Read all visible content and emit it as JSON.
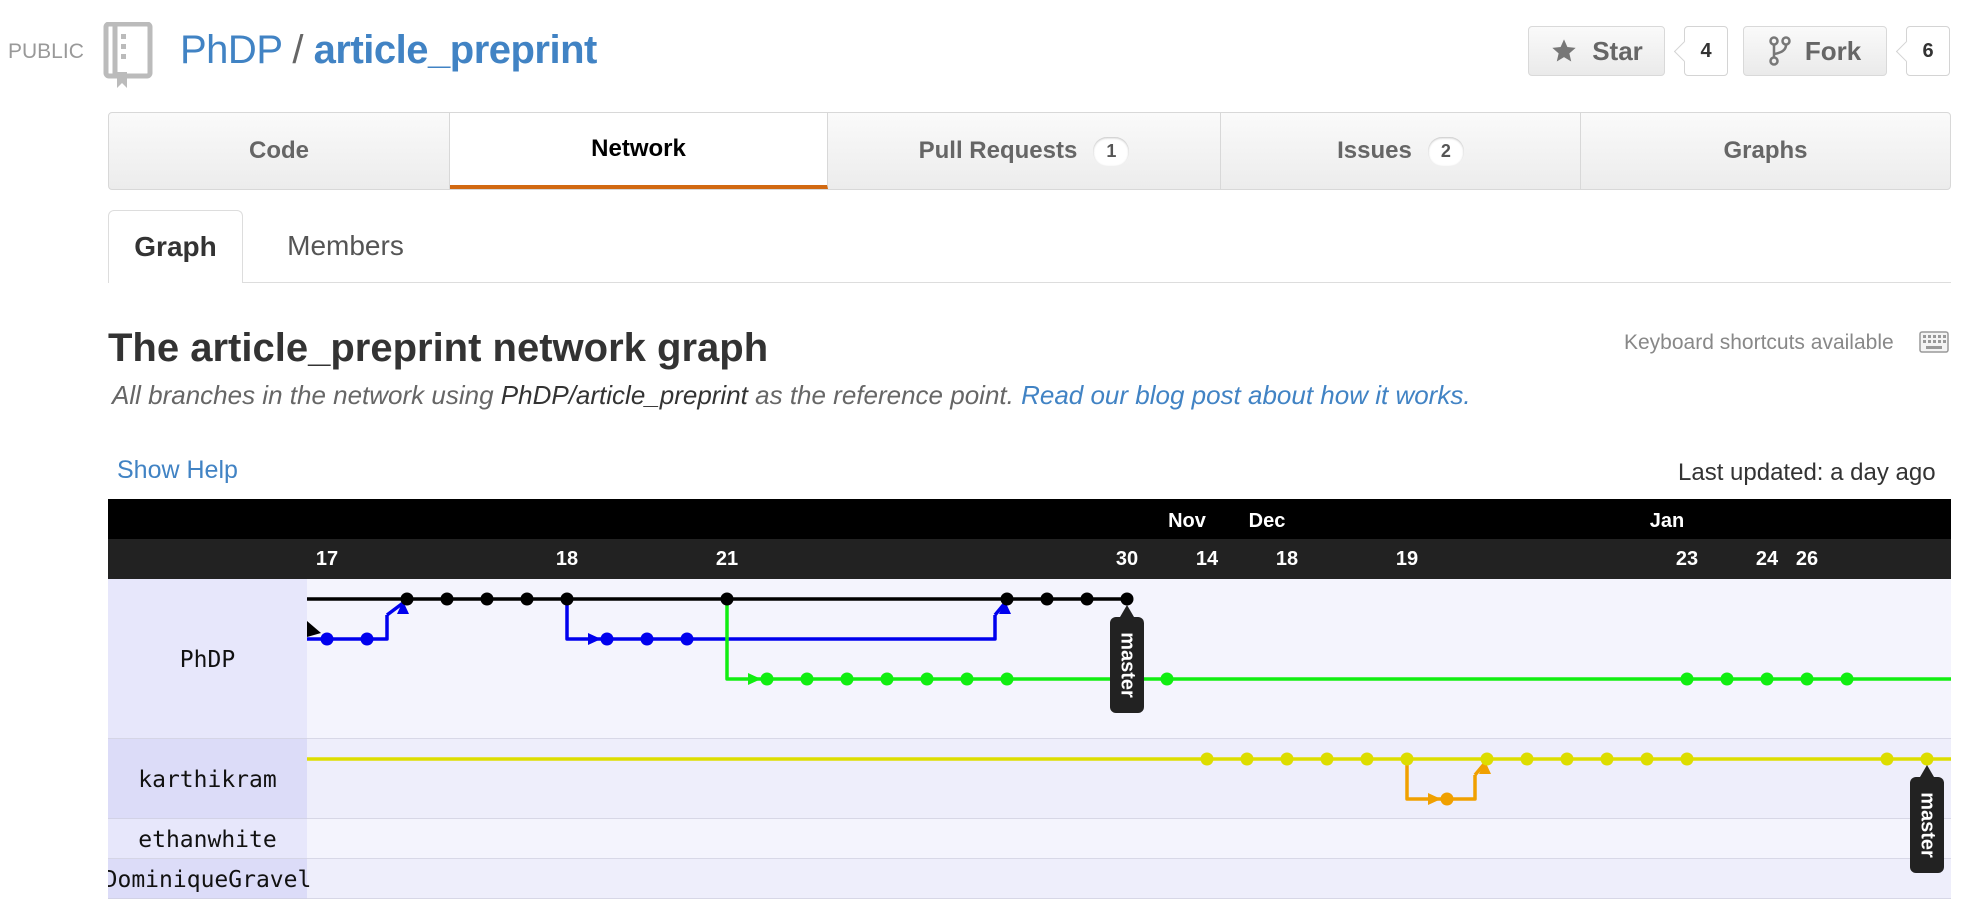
{
  "header": {
    "visibility": "PUBLIC",
    "owner": "PhDP",
    "separator": "/",
    "repo": "article_preprint",
    "star_label": "Star",
    "star_count": "4",
    "fork_label": "Fork",
    "fork_count": "6"
  },
  "tabs": [
    {
      "label": "Code"
    },
    {
      "label": "Network",
      "selected": true
    },
    {
      "label": "Pull Requests",
      "count": "1"
    },
    {
      "label": "Issues",
      "count": "2"
    },
    {
      "label": "Graphs"
    }
  ],
  "subnav": [
    {
      "label": "Graph",
      "selected": true
    },
    {
      "label": "Members"
    }
  ],
  "page": {
    "heading": "The article_preprint network graph",
    "keyboard_shortcuts": "Keyboard shortcuts available",
    "desc_prefix": "All branches in the network using ",
    "desc_ref": "PhDP/article_preprint",
    "desc_mid": " as the reference point. ",
    "desc_link": "Read our blog post about how it works.",
    "show_help": "Show Help",
    "last_updated": "Last updated: a day ago"
  },
  "graph": {
    "months": [
      {
        "label": "Nov",
        "col": 22.5
      },
      {
        "label": "Dec",
        "col": 24.5
      },
      {
        "label": "Jan",
        "col": 34.5
      }
    ],
    "days": [
      {
        "label": "17",
        "col": 1
      },
      {
        "label": "18",
        "col": 7
      },
      {
        "label": "21",
        "col": 11
      },
      {
        "label": "30",
        "col": 21
      },
      {
        "label": "14",
        "col": 23
      },
      {
        "label": "18",
        "col": 25
      },
      {
        "label": "19",
        "col": 28
      },
      {
        "label": "23",
        "col": 35
      },
      {
        "label": "24",
        "col": 37
      },
      {
        "label": "26",
        "col": 38
      }
    ],
    "users": [
      {
        "name": "PhDP",
        "rows": 4
      },
      {
        "name": "karthikram",
        "rows": 2
      },
      {
        "name": "ethanwhite",
        "rows": 1
      },
      {
        "name": "DominiqueGravel",
        "rows": 1
      }
    ],
    "colors": {
      "black": "#000000",
      "blue": "#0000ee",
      "green": "#11ee11",
      "yellow": "#dddd00",
      "orange": "#f0a000"
    },
    "commits": [
      {
        "color": "black",
        "row": 1,
        "cols": [
          3,
          4,
          5,
          6,
          7,
          11,
          18,
          19,
          20,
          21
        ]
      },
      {
        "color": "blue",
        "row": 2,
        "cols": [
          1,
          2,
          8,
          9,
          10
        ]
      },
      {
        "color": "green",
        "row": 3,
        "cols": [
          12,
          13,
          14,
          15,
          16,
          17,
          18,
          22,
          35,
          36,
          37,
          38,
          39
        ]
      },
      {
        "color": "yellow",
        "row": 5,
        "cols": [
          23,
          24,
          25,
          26,
          27,
          28,
          30,
          31,
          32,
          33,
          34,
          35,
          40,
          41
        ]
      },
      {
        "color": "orange",
        "row": 6,
        "cols": [
          29
        ]
      }
    ],
    "tags": [
      {
        "label": "master",
        "col": 21,
        "row": 1
      },
      {
        "label": "master",
        "col": 41,
        "row": 5
      }
    ]
  }
}
